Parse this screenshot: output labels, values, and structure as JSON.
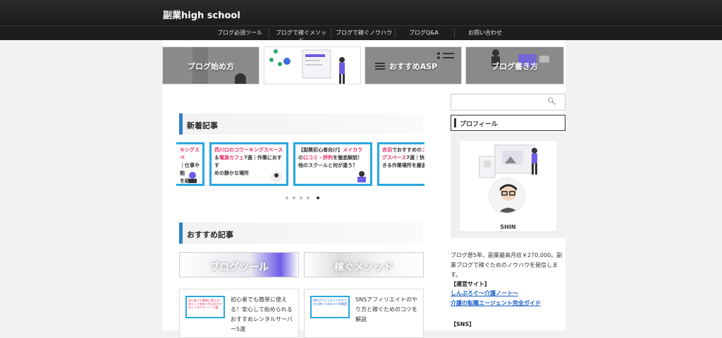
{
  "site": {
    "title": "副業high school"
  },
  "nav": [
    {
      "label": "ブログ必須ツール"
    },
    {
      "label": "ブログで稼ぐメソッド"
    },
    {
      "label": "ブログで稼ぐノウハウ"
    },
    {
      "label": "ブログQ&A"
    },
    {
      "label": "お問い合わせ"
    }
  ],
  "banners": [
    {
      "label": "ブログ始め方"
    },
    {
      "label": ""
    },
    {
      "label": "おすすめASP"
    },
    {
      "label": "ブログ書き方"
    }
  ],
  "new_posts": {
    "heading": "新着記事",
    "cards": [
      {
        "line1": "キングスペ",
        "line2": "｜仕事や勉",
        "line3": "を紹介！"
      },
      {
        "line1_red": "西川口のコワーキングスペース",
        "line2_pre": "＆",
        "line2_red": "電源カフェ",
        "line2_post": "7選｜作業におすす",
        "line3": "めの静かな場所"
      },
      {
        "line1_pre": "【副業初心者向け】",
        "line1_red": "メイカラ",
        "line2_pre": "の",
        "line2_red": "口コミ・評判",
        "line2_post": "を徹底解説！",
        "line3": "他のスクールと何が違う？"
      },
      {
        "line1_pre": "赤羽",
        "line1_post": "でおすすめの",
        "line1_red": "コ",
        "line2_red": "グスペース",
        "line2_post": "7選｜快",
        "line3": "きる作業場所を厳選"
      }
    ],
    "dots": 5,
    "active_dot": 4
  },
  "recommended": {
    "heading": "おすすめ記事",
    "buttons": [
      {
        "label": "ブログツール"
      },
      {
        "label": "稼ぐメソッド"
      }
    ],
    "cards": [
      {
        "thumb": "初心者でも簡単に使える！安心して始められるおすすめレンタルサーバー5選",
        "title": "初心者でも簡単に使える！安心して始められるおすすめレンタルサーバー5選"
      },
      {
        "thumb": "SNSアフィリエイトのやり方と稼ぐためのコツを解説",
        "title": "SNSアフィリエイトのやり方と稼ぐためのコツを解説"
      }
    ]
  },
  "sidebar": {
    "profile_heading": "プロフィール",
    "profile_name": "SHIN",
    "bio": "ブログ歴5年、副業最高月収￥270,000。副業ブログで稼ぐためのノウハウを発信します。",
    "sites_heading": "【運営サイト】",
    "sites": [
      {
        "label": "しんぶろぐ〜介護ノート〜"
      },
      {
        "label": "介護の転職エージェント完全ガイド"
      }
    ],
    "sns_heading": "【SNS】"
  },
  "colors": {
    "accent": "#2f7fc8",
    "card_border": "#29a8e0",
    "highlight": "#e8306a",
    "link": "#1a5fc8"
  }
}
